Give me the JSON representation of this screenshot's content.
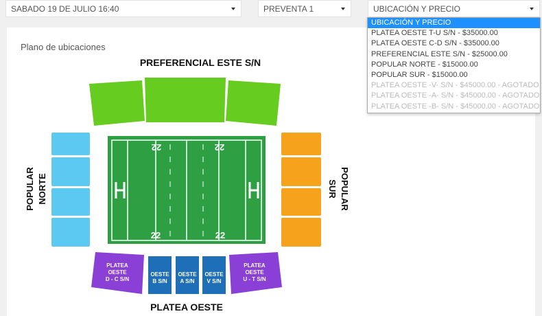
{
  "filters": {
    "date": "SABADO 19 DE JULIO 16:40",
    "presale": "PREVENTA 1",
    "location": "UBICACIÓN Y PRECIO"
  },
  "dropdown": {
    "options": [
      {
        "label": "UBICACIÓN Y PRECIO",
        "state": "selected"
      },
      {
        "label": "PLATEA OESTE T-U S/N - $35000.00",
        "state": "enabled"
      },
      {
        "label": "PLATEA OESTE C-D S/N - $35000.00",
        "state": "enabled"
      },
      {
        "label": "PREFERENCIAL ESTE S/N - $25000.00",
        "state": "enabled"
      },
      {
        "label": "POPULAR NORTE - $15000.00",
        "state": "enabled"
      },
      {
        "label": "POPULAR SUR - $15000.00",
        "state": "enabled"
      },
      {
        "label": "PLATEA OESTE -V- S/N - $45000.00 - AGOTADO",
        "state": "disabled"
      },
      {
        "label": "PLATEA OESTE -A- S/N - $45000.00 - AGOTADO",
        "state": "disabled"
      },
      {
        "label": "PLATEA OESTE -B- S/N - $45000.00 - AGOTADO",
        "state": "disabled"
      }
    ]
  },
  "plan": {
    "title": "Plano de ubicaciones",
    "east_label": "PREFERENCIAL ESTE S/N",
    "west_label": "PLATEA OESTE",
    "north_label_1": "POPULAR",
    "north_label_2": "NORTE",
    "south_label_1": "POPULAR",
    "south_label_2": "SUR",
    "field_marks": [
      "22",
      "22",
      "22",
      "22"
    ],
    "sections": {
      "west_dc": [
        "PLATEA",
        "OESTE",
        "D - C S/N"
      ],
      "west_b": [
        "OESTE",
        "B S/N"
      ],
      "west_a": [
        "OESTE",
        "A S/N"
      ],
      "west_v": [
        "OESTE",
        "V S/N"
      ],
      "west_ut": [
        "PLATEA",
        "OESTE",
        "U - T S/N"
      ]
    }
  },
  "colors": {
    "east": "#66cc1f",
    "north": "#5bc9f2",
    "south": "#f7a21c",
    "west_purple": "#8a3fd6",
    "west_blue": "#1e6fb8",
    "field": "#2ea043",
    "selected": "#1e90ff"
  }
}
